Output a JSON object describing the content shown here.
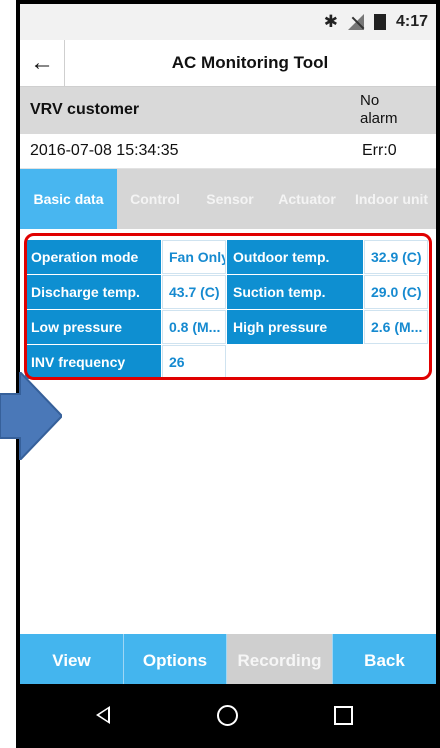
{
  "status_bar": {
    "time": "4:17",
    "icons": [
      "bluetooth-icon",
      "signal-icon",
      "battery-icon"
    ]
  },
  "app_bar": {
    "back_icon": "←",
    "title": "AC Monitoring Tool"
  },
  "customer": {
    "name": "VRV customer",
    "alarm_status": "No alarm"
  },
  "info": {
    "datetime": "2016-07-08 15:34:35",
    "error": "Err:0"
  },
  "tabs": [
    {
      "label": "Basic data",
      "active": true
    },
    {
      "label": "Control",
      "active": false
    },
    {
      "label": "Sensor",
      "active": false
    },
    {
      "label": "Actuator",
      "active": false
    },
    {
      "label": "Indoor unit",
      "active": false
    }
  ],
  "basic_data": {
    "rows": [
      [
        {
          "label": "Operation mode",
          "value": "Fan Only"
        },
        {
          "label": "Outdoor temp.",
          "value": "32.9 (C)"
        }
      ],
      [
        {
          "label": "Discharge temp.",
          "value": "43.7 (C)"
        },
        {
          "label": "Suction temp.",
          "value": "29.0 (C)"
        }
      ],
      [
        {
          "label": "Low pressure",
          "value": "0.8 (M..."
        },
        {
          "label": "High pressure",
          "value": "2.6 (M..."
        }
      ],
      [
        {
          "label": "INV frequency",
          "value": "26"
        }
      ]
    ]
  },
  "bottom_buttons": {
    "view": "View",
    "options": "Options",
    "recording": "Recording",
    "back": "Back"
  },
  "colors": {
    "accent": "#44b5ee",
    "label_cell": "#0e8fd1",
    "value_text": "#168ad0",
    "highlight": "#e00000",
    "annotation_arrow": "#4a78b8"
  }
}
